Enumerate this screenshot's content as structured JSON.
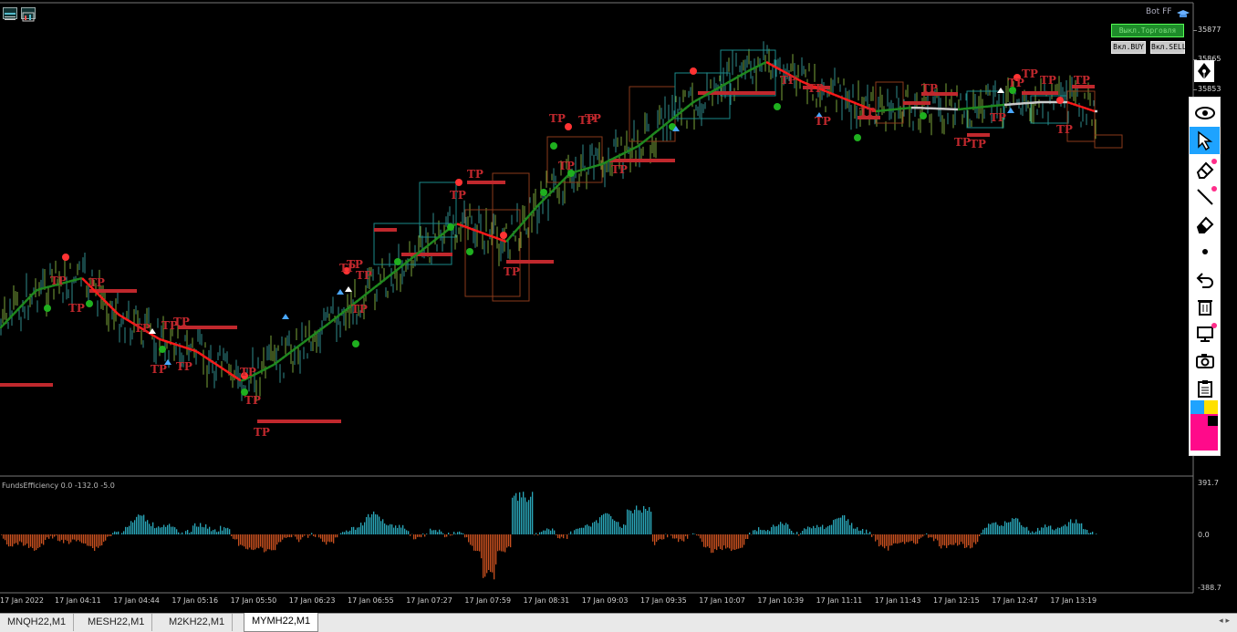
{
  "top_left": {
    "icons": [
      "chart-grid-icon",
      "chart-window-icon"
    ]
  },
  "expert": {
    "name": "Bot FF",
    "icon": "graduation-cap-icon"
  },
  "trade_panel": {
    "trading_toggle": "Выкл.Торговля",
    "buy_toggle": "Вкл.BUY",
    "sell_toggle": "Вкл.SELL"
  },
  "price_axis": {
    "labels": [
      "35877",
      "35865",
      "35853"
    ]
  },
  "trade_marker": {
    "label": "TP"
  },
  "toolbar": {
    "items": [
      {
        "name": "eye-icon",
        "active": false
      },
      {
        "name": "cursor-arrow-icon",
        "active": true
      },
      {
        "name": "eraser-icon",
        "active": false
      },
      {
        "name": "pencil-line-icon",
        "active": false
      },
      {
        "name": "clear-eraser-icon",
        "active": false
      },
      {
        "name": "dot-icon",
        "active": false
      },
      {
        "name": "undo-icon",
        "active": false
      },
      {
        "name": "trash-icon",
        "active": false
      },
      {
        "name": "screen-icon",
        "active": false
      },
      {
        "name": "camera-icon",
        "active": false
      },
      {
        "name": "clipboard-icon",
        "active": false
      }
    ],
    "colors": [
      "#1ea3ff",
      "#ffe000",
      "#ff0a8a",
      "#000000"
    ]
  },
  "indicator": {
    "label": "FundsEfficiency 0.0 -132.0 -5.0",
    "axis": [
      "391.7",
      "0.0",
      "-388.7"
    ]
  },
  "time_axis": [
    "17 Jan 2022",
    "17 Jan 04:11",
    "17 Jan 04:44",
    "17 Jan 05:16",
    "17 Jan 05:50",
    "17 Jan 06:23",
    "17 Jan 06:55",
    "17 Jan 07:27",
    "17 Jan 07:59",
    "17 Jan 08:31",
    "17 Jan 09:03",
    "17 Jan 09:35",
    "17 Jan 10:07",
    "17 Jan 10:39",
    "17 Jan 11:11",
    "17 Jan 11:43",
    "17 Jan 12:15",
    "17 Jan 12:47",
    "17 Jan 13:19"
  ],
  "tabs": {
    "items": [
      "MNQH22,M1",
      "MESH22,M1",
      "M2KH22,M1",
      "MYMH22,M1"
    ],
    "active": "MYMH22,M1"
  },
  "colors": {
    "uptrend": "#1f8a1f",
    "downtrend": "#ff1a1a",
    "flat": "#cccccc",
    "tp": "#c0282d",
    "hist_up": "#2aa6b8",
    "hist_down": "#c8501f"
  }
}
